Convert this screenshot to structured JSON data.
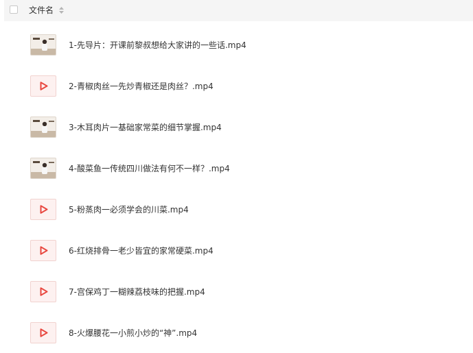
{
  "header": {
    "column_title": "文件名"
  },
  "files": [
    {
      "name": "1-先导片：开课前黎叔想给大家讲的一些话.mp4",
      "thumb": "photo"
    },
    {
      "name": "2-青椒肉丝一先炒青椒还是肉丝？.mp4",
      "thumb": "video"
    },
    {
      "name": "3-木耳肉片一基础家常菜的细节掌握.mp4",
      "thumb": "photo"
    },
    {
      "name": "4-酸菜鱼一传统四川做法有何不一样？.mp4",
      "thumb": "photo"
    },
    {
      "name": "5-粉蒸肉一必须学会的川菜.mp4",
      "thumb": "video"
    },
    {
      "name": "6-红烧排骨一老少皆宜的家常硬菜.mp4",
      "thumb": "video"
    },
    {
      "name": "7-宫保鸡丁一糊辣荔枝味的把握.mp4",
      "thumb": "video"
    },
    {
      "name": "8-火爆腰花一小煎小炒的“神”.mp4",
      "thumb": "video"
    }
  ],
  "icons": {
    "sort": "sort-icon",
    "video": "video-file-icon",
    "thumbnail": "video-thumbnail"
  },
  "colors": {
    "play_icon": "#e8473f",
    "header_bg": "#f5f5f5"
  }
}
